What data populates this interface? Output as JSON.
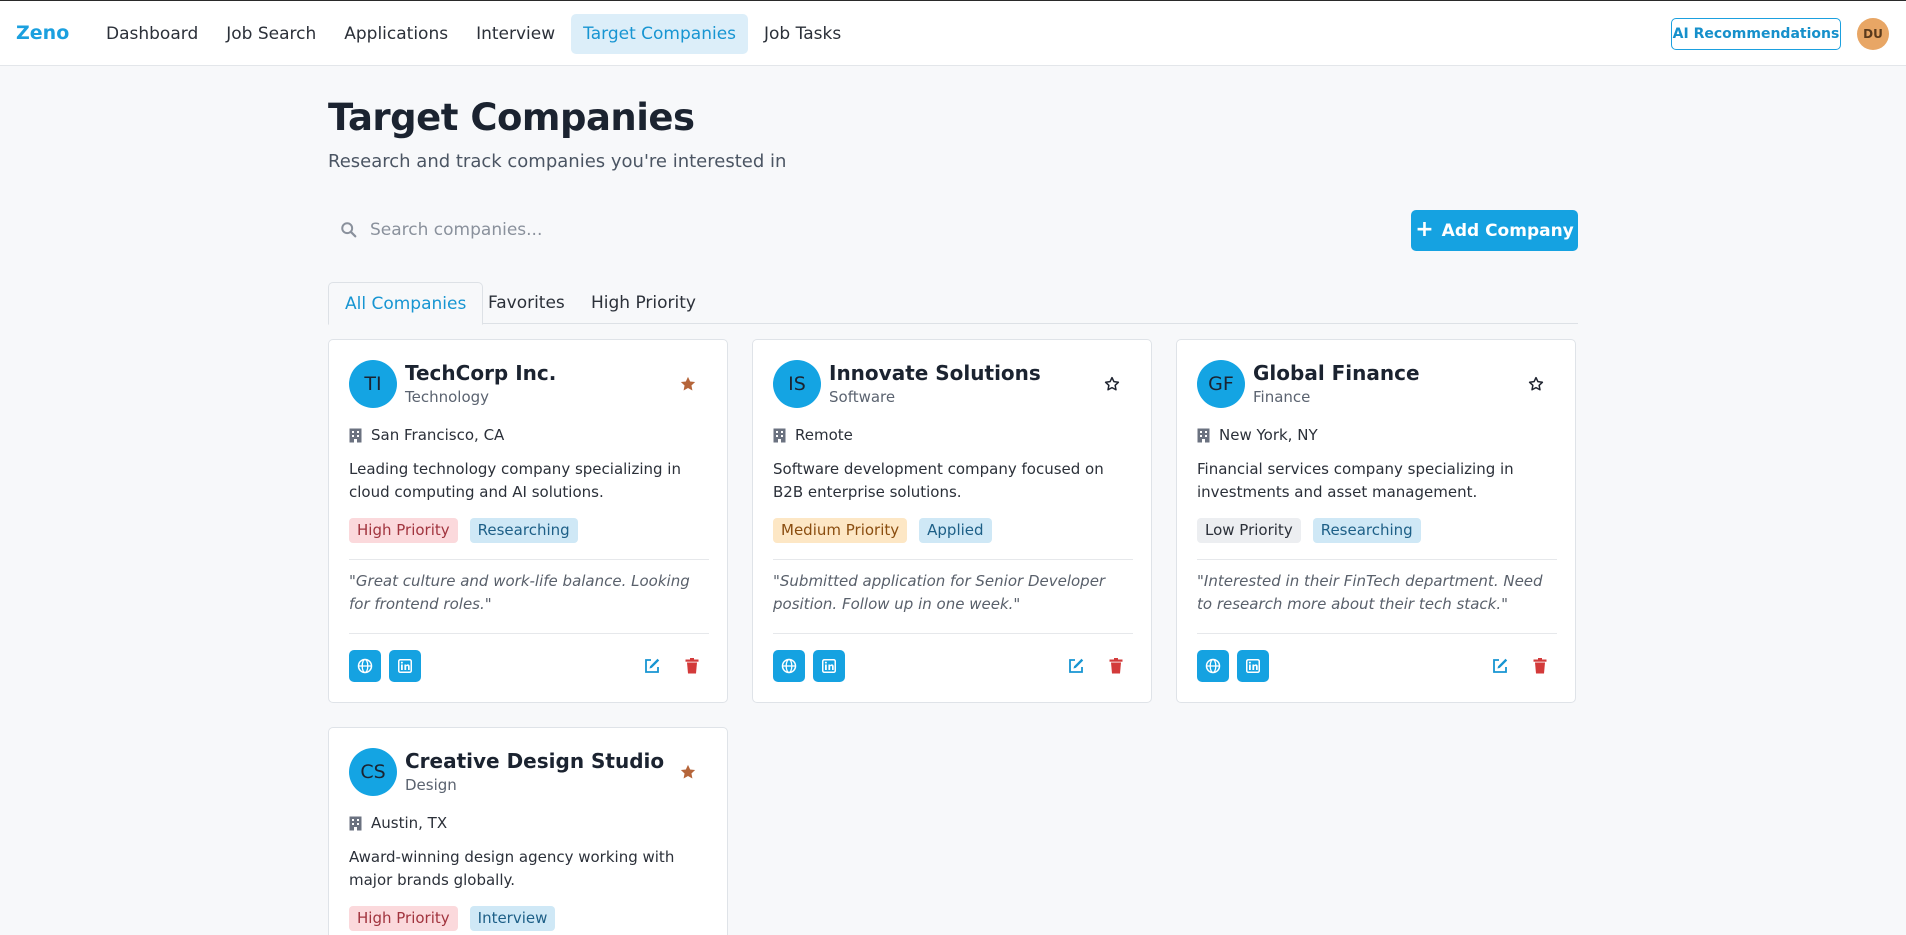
{
  "app": {
    "brand": "Zeno"
  },
  "nav": {
    "items": [
      {
        "label": "Dashboard"
      },
      {
        "label": "Job Search"
      },
      {
        "label": "Applications"
      },
      {
        "label": "Interview"
      },
      {
        "label": "Target Companies",
        "active": true
      },
      {
        "label": "Job Tasks"
      }
    ],
    "ai_button": "AI Recommendations",
    "user_initials": "DU"
  },
  "page": {
    "title": "Target Companies",
    "subtitle": "Research and track companies you're interested in"
  },
  "search": {
    "placeholder": "Search companies...",
    "value": ""
  },
  "add_button": {
    "label": "Add Company",
    "icon": "plus-icon"
  },
  "tabs": [
    {
      "label": "All Companies",
      "active": true
    },
    {
      "label": "Favorites"
    },
    {
      "label": "High Priority"
    }
  ],
  "colors": {
    "accent": "#15a2e1",
    "favorite": "#b5653a",
    "danger": "#d33a3a"
  },
  "companies": [
    {
      "initials": "TI",
      "name": "TechCorp Inc.",
      "industry": "Technology",
      "favorite": true,
      "location": "San Francisco, CA",
      "description": "Leading technology company specializing in cloud computing and AI solutions.",
      "priority": "High Priority",
      "status": "Researching",
      "note": "\"Great culture and work-life balance. Looking for frontend roles.\""
    },
    {
      "initials": "IS",
      "name": "Innovate Solutions",
      "industry": "Software",
      "favorite": false,
      "location": "Remote",
      "description": "Software development company focused on B2B enterprise solutions.",
      "priority": "Medium Priority",
      "status": "Applied",
      "note": "\"Submitted application for Senior Developer position. Follow up in one week.\""
    },
    {
      "initials": "GF",
      "name": "Global Finance",
      "industry": "Finance",
      "favorite": false,
      "location": "New York, NY",
      "description": "Financial services company specializing in investments and asset management.",
      "priority": "Low Priority",
      "status": "Researching",
      "note": "\"Interested in their FinTech department. Need to research more about their tech stack.\""
    },
    {
      "initials": "CS",
      "name": "Creative Design Studio",
      "industry": "Design",
      "favorite": true,
      "location": "Austin, TX",
      "description": "Award-winning design agency working with major brands globally.",
      "priority": "High Priority",
      "status": "Interview"
    }
  ]
}
